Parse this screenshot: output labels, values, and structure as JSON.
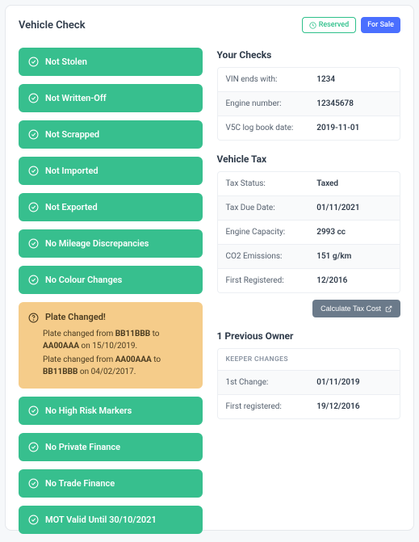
{
  "header": {
    "title": "Vehicle Check",
    "reserved_label": "Reserved",
    "for_sale_label": "For Sale"
  },
  "status_items": [
    {
      "type": "ok",
      "label": "Not Stolen"
    },
    {
      "type": "ok",
      "label": "Not Written-Off"
    },
    {
      "type": "ok",
      "label": "Not Scrapped"
    },
    {
      "type": "ok",
      "label": "Not Imported"
    },
    {
      "type": "ok",
      "label": "Not Exported"
    },
    {
      "type": "ok",
      "label": "No Mileage Discrepancies"
    },
    {
      "type": "ok",
      "label": "No Colour Changes"
    },
    {
      "type": "warn",
      "title": "Plate Changed!",
      "lines": [
        {
          "prefix": "Plate changed from ",
          "b1": "BB11BBB",
          "mid": " to ",
          "b2": "AA00AAA",
          "suffix": " on 15/10/2019."
        },
        {
          "prefix": "Plate changed from ",
          "b1": "AA00AAA",
          "mid": " to ",
          "b2": "BB11BBB",
          "suffix": " on 04/02/2017."
        }
      ]
    },
    {
      "type": "ok",
      "label": "No High Risk Markers"
    },
    {
      "type": "ok",
      "label": "No Private Finance"
    },
    {
      "type": "ok",
      "label": "No Trade Finance"
    },
    {
      "type": "ok",
      "label": "MOT Valid Until 30/10/2021"
    }
  ],
  "your_checks": {
    "title": "Your Checks",
    "rows": [
      {
        "label": "VIN ends with:",
        "value": "1234"
      },
      {
        "label": "Engine number:",
        "value": "12345678"
      },
      {
        "label": "V5C log book date:",
        "value": "2019-11-01"
      }
    ]
  },
  "vehicle_tax": {
    "title": "Vehicle Tax",
    "rows": [
      {
        "label": "Tax Status:",
        "value": "Taxed"
      },
      {
        "label": "Tax Due Date:",
        "value": "01/11/2021"
      },
      {
        "label": "Engine Capacity:",
        "value": "2993 cc"
      },
      {
        "label": "CO2 Emissions:",
        "value": "151 g/km"
      },
      {
        "label": "First Registered:",
        "value": "12/2016"
      }
    ],
    "calc_button": "Calculate Tax Cost"
  },
  "previous_owner": {
    "title": "1 Previous Owner",
    "header": "KEEPER CHANGES",
    "rows": [
      {
        "label": "1st Change:",
        "value": "01/11/2019"
      },
      {
        "label": "First registered:",
        "value": "19/12/2016"
      }
    ]
  }
}
